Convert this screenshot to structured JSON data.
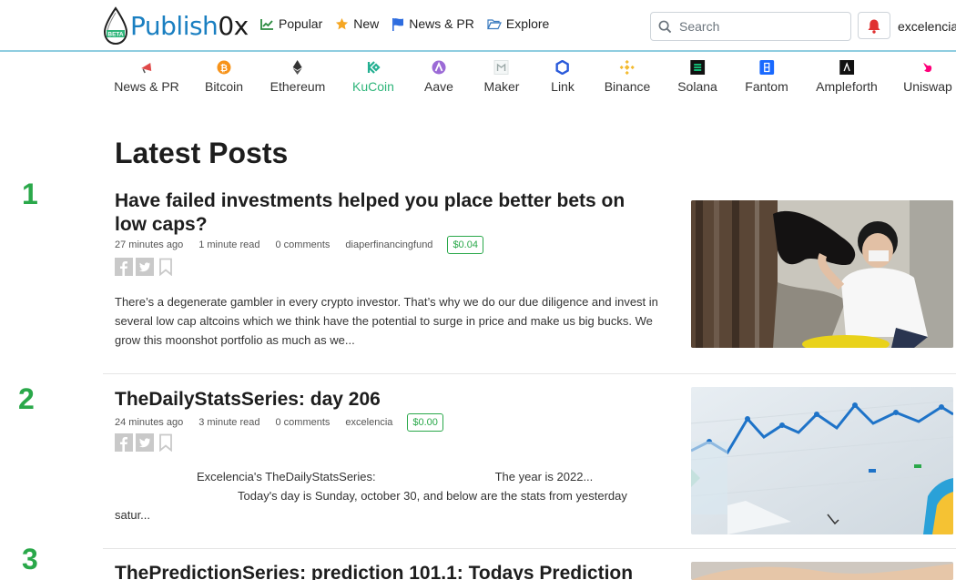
{
  "header": {
    "logo_brand": "Publish",
    "logo_suffix": "0x",
    "logo_badge": "BETA",
    "nav": [
      {
        "label": "Popular",
        "icon": "chart-line-icon"
      },
      {
        "label": "New",
        "icon": "star-icon"
      },
      {
        "label": "News & PR",
        "icon": "flag-icon"
      },
      {
        "label": "Explore",
        "icon": "folder-open-icon"
      }
    ],
    "search_placeholder": "Search",
    "username": "excelencia"
  },
  "categories": [
    {
      "label": "News & PR",
      "icon": "megaphone-icon",
      "color": "#e04848"
    },
    {
      "label": "Bitcoin",
      "icon": "bitcoin-icon",
      "color": "#f7931a"
    },
    {
      "label": "Ethereum",
      "icon": "ethereum-icon",
      "color": "#333333"
    },
    {
      "label": "KuCoin",
      "icon": "kucoin-icon",
      "color": "#23af91",
      "active": true
    },
    {
      "label": "Aave",
      "icon": "aave-icon",
      "color": "#9b6ad6"
    },
    {
      "label": "Maker",
      "icon": "maker-icon",
      "color": "#9aa7a6"
    },
    {
      "label": "Link",
      "icon": "chainlink-icon",
      "color": "#2a5ada"
    },
    {
      "label": "Binance",
      "icon": "binance-icon",
      "color": "#f3ba2f"
    },
    {
      "label": "Solana",
      "icon": "solana-icon",
      "color": "#111111"
    },
    {
      "label": "Fantom",
      "icon": "fantom-icon",
      "color": "#1969ff"
    },
    {
      "label": "Ampleforth",
      "icon": "ampleforth-icon",
      "color": "#111111"
    },
    {
      "label": "Uniswap",
      "icon": "uniswap-icon",
      "color": "#ff007a"
    }
  ],
  "main": {
    "heading": "Latest Posts",
    "posts": [
      {
        "rank": "1",
        "title": "Have failed investments helped you place better bets on low caps?",
        "time": "27 minutes ago",
        "read": "1 minute read",
        "comments": "0 comments",
        "author": "diaperfinancingfund",
        "tips": "$0.04",
        "excerpt": "There’s a degenerate gambler in every crypto investor. That’s why we do our due diligence and invest in several low cap altcoins which we think have the potential to surge in price and make us big bucks. We grow this moonshot portfolio as much as we..."
      },
      {
        "rank": "2",
        "title": "TheDailyStatsSeries: day 206",
        "time": "24 minutes ago",
        "read": "3 minute read",
        "comments": "0 comments",
        "author": "excelencia",
        "tips": "$0.00",
        "excerpt_line1a": "Excelencia's TheDailyStatsSeries:",
        "excerpt_line1b": "The year is 2022...",
        "excerpt_line2": "Today's day is Sunday, october 30, and below are the stats from yesterday",
        "excerpt_line3": "satur..."
      },
      {
        "rank": "3",
        "title": "ThePredictionSeries: prediction 101.1: Todays Prediction"
      }
    ]
  }
}
